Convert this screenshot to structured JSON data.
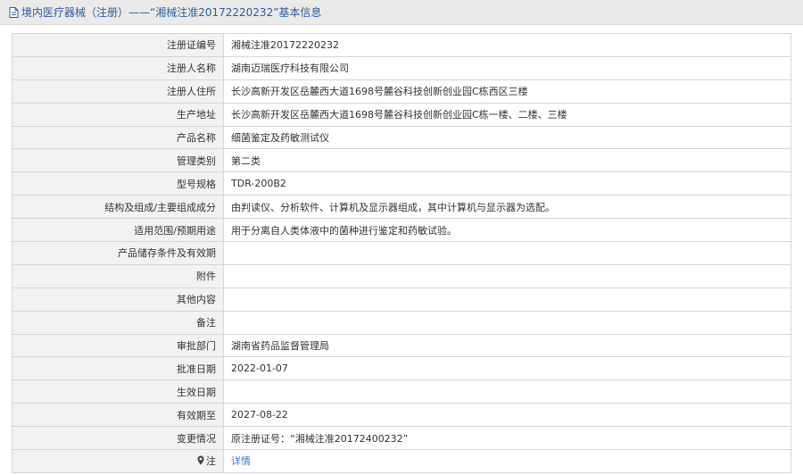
{
  "header": {
    "title": "境内医疗器械（注册）——“湘械注准20172220232”基本信息"
  },
  "rows": [
    {
      "label": "注册证编号",
      "value": "湘械注准20172220232"
    },
    {
      "label": "注册人名称",
      "value": "湖南迈瑞医疗科技有限公司"
    },
    {
      "label": "注册人住所",
      "value": "长沙高新开发区岳麓西大道1698号麓谷科技创新创业园C栋西区三楼"
    },
    {
      "label": "生产地址",
      "value": "长沙高新开发区岳麓西大道1698号麓谷科技创新创业园C栋一楼、二楼、三楼"
    },
    {
      "label": "产品名称",
      "value": "细菌鉴定及药敏测试仪"
    },
    {
      "label": "管理类别",
      "value": "第二类"
    },
    {
      "label": "型号规格",
      "value": "TDR-200B2"
    },
    {
      "label": "结构及组成/主要组成成分",
      "value": "由判读仪、分析软件、计算机及显示器组成，其中计算机与显示器为选配。"
    },
    {
      "label": "适用范围/预期用途",
      "value": "用于分离自人类体液中的菌种进行鉴定和药敏试验。"
    },
    {
      "label": "产品储存条件及有效期",
      "value": ""
    },
    {
      "label": "附件",
      "value": ""
    },
    {
      "label": "其他内容",
      "value": ""
    },
    {
      "label": "备注",
      "value": ""
    },
    {
      "label": "审批部门",
      "value": "湖南省药品监督管理局"
    },
    {
      "label": "批准日期",
      "value": "2022-01-07"
    },
    {
      "label": "生效日期",
      "value": ""
    },
    {
      "label": "有效期至",
      "value": "2027-08-22"
    },
    {
      "label": "变更情况",
      "value": "原注册证号：“湘械注准20172400232”"
    }
  ],
  "note_row": {
    "label": "注",
    "link": "详情"
  }
}
